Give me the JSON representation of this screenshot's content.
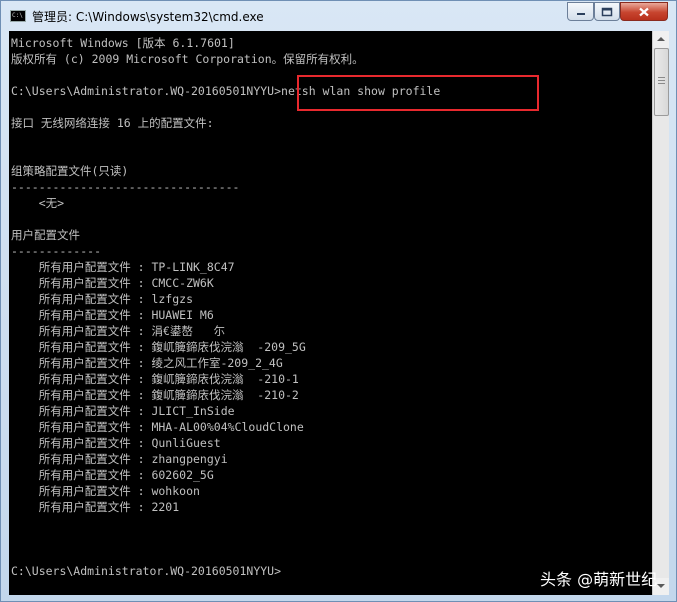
{
  "window": {
    "title": "管理员: C:\\Windows\\system32\\cmd.exe",
    "icon_label": "C:\\",
    "icon": "cmd-icon",
    "controls": [
      "minimize-icon",
      "maximize-icon",
      "close-icon"
    ]
  },
  "console": {
    "text_color": "#c0c0c0",
    "background": "#000000",
    "highlight_color": "#e8292e",
    "lines": [
      "Microsoft Windows [版本 6.1.7601]",
      "版权所有 (c) 2009 Microsoft Corporation。保留所有权利。",
      "",
      "C:\\Users\\Administrator.WQ-20160501NYYU>netsh wlan show profile",
      "",
      "接口 无线网络连接 16 上的配置文件:",
      "",
      "",
      "组策略配置文件(只读)",
      "---------------------------------",
      "    <无>",
      "",
      "用户配置文件",
      "-------------",
      "    所有用户配置文件 : TP-LINK_8C47",
      "    所有用户配置文件 : CMCC-ZW6K",
      "    所有用户配置文件 : lzfgzs",
      "    所有用户配置文件 : HUAWEI M6",
      "    所有用户配置文件 : 涓€鍙嶅   尓",
      "    所有用户配置文件 : 鍑屼簲鍗庡伐浣滃  -209_5G",
      "    所有用户配置文件 : 绫之风工作室-209_2_4G",
      "    所有用户配置文件 : 鍑屼簲鍗庡伐浣滃  -210-1",
      "    所有用户配置文件 : 鍑屼簲鍗庡伐浣滃  -210-2",
      "    所有用户配置文件 : JLICT_InSide",
      "    所有用户配置文件 : MHA-AL00%04%CloudClone",
      "    所有用户配置文件 : QunliGuest",
      "    所有用户配置文件 : zhangpengyi",
      "    所有用户配置文件 : 602602_5G",
      "    所有用户配置文件 : wohkoon",
      "    所有用户配置文件 : 2201",
      "",
      "",
      "",
      "C:\\Users\\Administrator.WQ-20160501NYYU>"
    ]
  },
  "watermark": "头条 @萌新世纪"
}
